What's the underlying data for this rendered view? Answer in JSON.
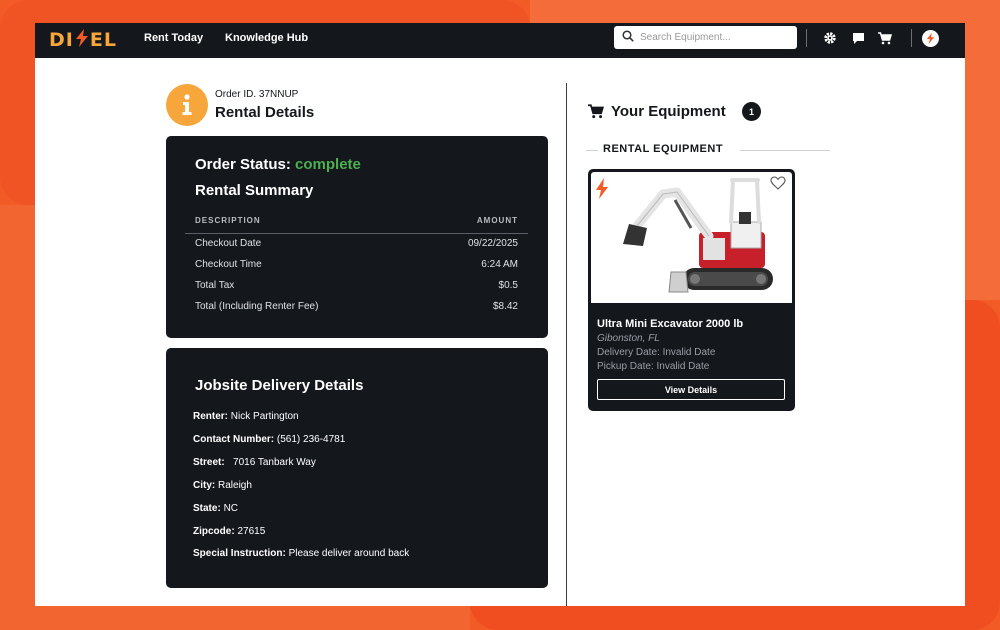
{
  "brand": {
    "logo_left": "DI",
    "logo_right": "EL"
  },
  "nav": {
    "links": [
      "Rent Today",
      "Knowledge Hub"
    ],
    "search_placeholder": "Search Equipment..."
  },
  "order": {
    "id_label": "Order ID. 37NNUP",
    "title": "Rental Details",
    "status_label": "Order Status:",
    "status_value": "complete",
    "summary_title": "Rental Summary",
    "columns": [
      "DESCRIPTION",
      "AMOUNT"
    ],
    "rows": [
      {
        "desc": "Checkout Date",
        "amount": "09/22/2025"
      },
      {
        "desc": "Checkout Time",
        "amount": "6:24 AM"
      },
      {
        "desc": "Total Tax",
        "amount": "$0.5"
      },
      {
        "desc": "Total (Including Renter Fee)",
        "amount": "$8.42"
      }
    ]
  },
  "delivery": {
    "title": "Jobsite Delivery Details",
    "fields": [
      {
        "label": "Renter:",
        "value": "Nick Partington"
      },
      {
        "label": "Contact Number:",
        "value": "(561) 236-4781"
      },
      {
        "label": "Street:",
        "value": "7016 Tanbark Way"
      },
      {
        "label": "City:",
        "value": "Raleigh"
      },
      {
        "label": "State:",
        "value": "NC"
      },
      {
        "label": "Zipcode:",
        "value": "27615"
      },
      {
        "label": "Special Instruction:",
        "value": "Please deliver around back"
      }
    ]
  },
  "equipment": {
    "title": "Your Equipment",
    "count": "1",
    "section_label": "RENTAL EQUIPMENT",
    "item": {
      "name": "Ultra Mini Excavator 2000 lb",
      "location": "Gibonston, FL",
      "delivery": "Delivery Date: Invalid Date",
      "pickup": "Pickup Date: Invalid Date",
      "button": "View Details"
    }
  },
  "colors": {
    "accent_orange": "#f25a26",
    "logo_gold": "#f6a63b",
    "status_green": "#4caf50",
    "dark": "#14171c"
  }
}
